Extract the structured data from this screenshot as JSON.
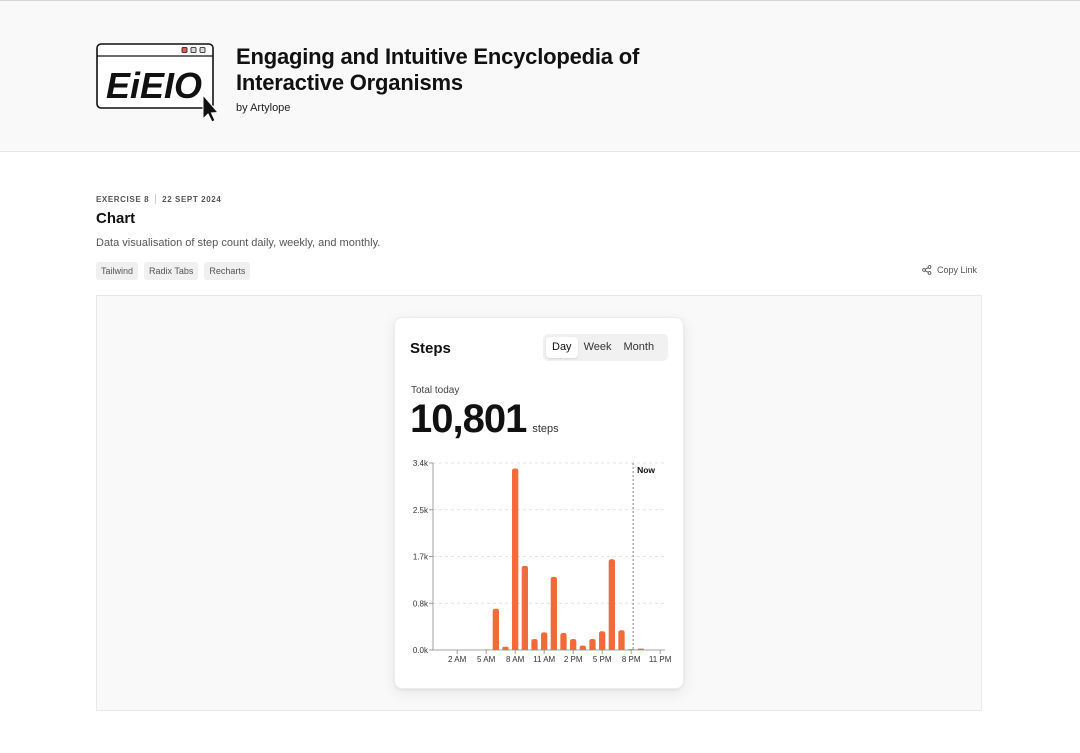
{
  "header": {
    "logo_text": "EiEIO",
    "title": "Engaging and Intuitive Encyclopedia of Interactive Organisms",
    "author": "by Artylope"
  },
  "exercise": {
    "label": "EXERCISE 8",
    "date": "22 SEPT 2024",
    "title": "Chart",
    "description": "Data visualisation of step count daily, weekly, and monthly.",
    "tags": [
      "Tailwind",
      "Radix Tabs",
      "Recharts"
    ],
    "copy_link": "Copy Link"
  },
  "card": {
    "title": "Steps",
    "tabs": [
      {
        "label": "Day",
        "active": true
      },
      {
        "label": "Week",
        "active": false
      },
      {
        "label": "Month",
        "active": false
      }
    ],
    "total_label": "Total today",
    "total_value": "10,801",
    "total_unit": "steps"
  },
  "chart_data": {
    "type": "bar",
    "title": "",
    "xlabel": "",
    "ylabel": "",
    "bar_color": "#f26a3a",
    "ylim": [
      0,
      3400
    ],
    "yticks": [
      0,
      850,
      1700,
      2550,
      3400
    ],
    "ytick_labels": [
      "0.0k",
      "0.8k",
      "1.7k",
      "2.5k",
      "3.4k"
    ],
    "grid": true,
    "hours": [
      0,
      1,
      2,
      3,
      4,
      5,
      6,
      7,
      8,
      9,
      10,
      11,
      12,
      13,
      14,
      15,
      16,
      17,
      18,
      19,
      20,
      21,
      22,
      23
    ],
    "values": [
      0,
      0,
      0,
      0,
      0,
      10,
      750,
      60,
      3300,
      1530,
      200,
      320,
      1330,
      310,
      200,
      80,
      200,
      340,
      1650,
      360,
      15,
      25,
      0,
      0
    ],
    "xticks": [
      2,
      5,
      8,
      11,
      14,
      17,
      20,
      23
    ],
    "xtick_labels": [
      "2 AM",
      "5 AM",
      "8 AM",
      "11 AM",
      "2 PM",
      "5 PM",
      "8 PM",
      "11 PM"
    ],
    "now_hour": 20.2,
    "now_label": "Now"
  }
}
